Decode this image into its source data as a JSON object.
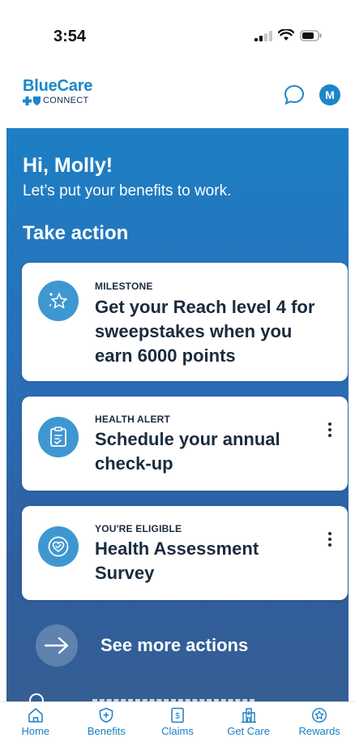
{
  "status_bar": {
    "time": "3:54"
  },
  "header": {
    "logo_title": "BlueCare",
    "logo_sub": "CONNECT",
    "avatar_initial": "M"
  },
  "main": {
    "greeting": "Hi, Molly!",
    "subgreeting": "Let’s put your benefits to work.",
    "section_title": "Take action",
    "cards": [
      {
        "tag": "MILESTONE",
        "title": "Get your Reach level 4 for sweepstakes when you earn 6000 points",
        "icon": "star-sparkle-icon",
        "has_menu": false
      },
      {
        "tag": "HEALTH ALERT",
        "title": "Schedule your annual check-up",
        "icon": "clipboard-check-icon",
        "has_menu": true
      },
      {
        "tag": "YOU'RE ELIGIBLE",
        "title": "Health Assessment Survey",
        "icon": "heart-check-icon",
        "has_menu": true
      }
    ],
    "see_more_label": "See more actions"
  },
  "bottom_nav": [
    {
      "label": "Home",
      "icon": "home-icon"
    },
    {
      "label": "Benefits",
      "icon": "shield-plus-icon"
    },
    {
      "label": "Claims",
      "icon": "dollar-document-icon"
    },
    {
      "label": "Get Care",
      "icon": "hospital-icon"
    },
    {
      "label": "Rewards",
      "icon": "star-badge-icon"
    }
  ],
  "colors": {
    "brand_blue": "#1b87c9",
    "navy": "#0f2c56",
    "card_icon_bg": "#3f97d2",
    "nav_active": "#1b7fc4"
  }
}
